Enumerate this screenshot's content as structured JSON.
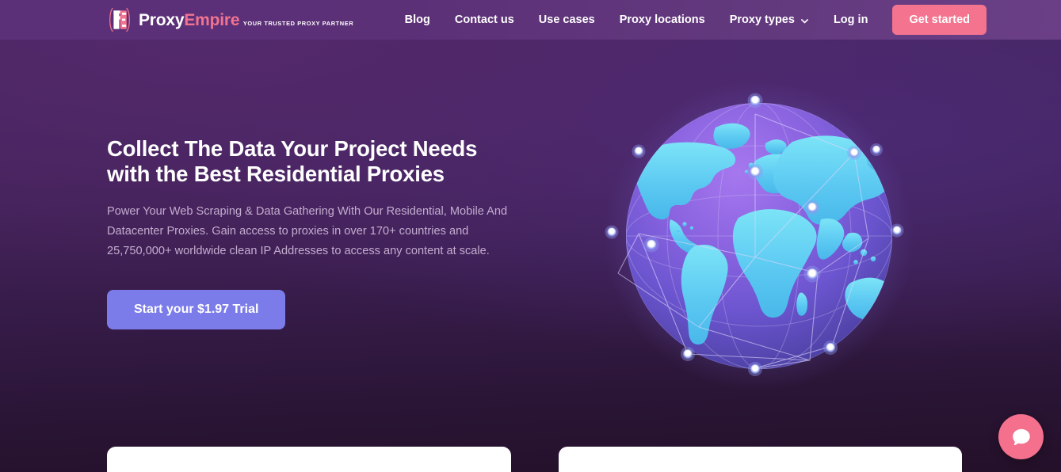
{
  "header": {
    "logo": {
      "icon": "proxyempire-monogram-icon",
      "title_part1": "Proxy",
      "title_part2": "Empire",
      "tagline": "YOUR TRUSTED PROXY PARTNER"
    },
    "nav": [
      {
        "label": "Blog",
        "name": "nav-link-blog",
        "dropdown": false
      },
      {
        "label": "Contact us",
        "name": "nav-link-contact-us",
        "dropdown": false
      },
      {
        "label": "Use cases",
        "name": "nav-link-use-cases",
        "dropdown": false
      },
      {
        "label": "Proxy locations",
        "name": "nav-link-proxy-locations",
        "dropdown": false
      },
      {
        "label": "Proxy types",
        "name": "nav-link-proxy-types",
        "dropdown": true
      },
      {
        "label": "Log in",
        "name": "nav-link-log-in",
        "dropdown": false
      }
    ],
    "cta_label": "Get started"
  },
  "hero": {
    "headline_line1": "Collect The Data Your Project Needs",
    "headline_line2": "with the Best Residential Proxies",
    "subcopy": "Power Your Web Scraping & Data Gathering With Our Residential, Mobile And Datacenter Proxies. Gain access to proxies in over 170+ countries and 25,750,000+ worldwide clean IP Addresses to access any content at scale.",
    "cta_label": "Start your $1.97 Trial",
    "illustration": "network-globe-illustration"
  },
  "chat_widget": {
    "icon": "chat-bubble-icon"
  },
  "colors": {
    "brand_pink": "#f4738e",
    "cta_periwinkle": "#7b7bea",
    "header_purple": "#5b3079",
    "background_purple": "#452560",
    "globe_cyan": "#6fd7f2",
    "text_muted": "#c3adcf"
  }
}
